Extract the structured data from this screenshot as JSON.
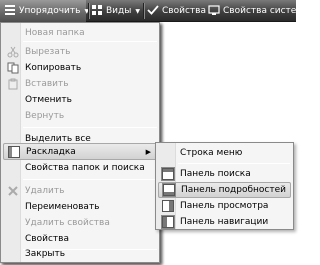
{
  "toolbar": {
    "organize": "Упорядочить",
    "views": "Виды",
    "properties": "Свойства",
    "system_properties": "Свойства системы"
  },
  "menu": {
    "new_folder": "Новая папка",
    "cut": "Вырезать",
    "copy": "Копировать",
    "paste": "Вставить",
    "undo": "Отменить",
    "redo": "Вернуть",
    "select_all": "Выделить все",
    "layout": "Раскладка",
    "folder_search_options": "Свойства папок и поиска",
    "delete": "Удалить",
    "rename": "Переименовать",
    "remove_properties": "Удалить свойства",
    "properties": "Свойства",
    "close": "Закрыть"
  },
  "submenu": {
    "menu_bar": "Строка меню",
    "search_pane": "Панель поиска",
    "details_pane": "Панель подробностей",
    "preview_pane": "Панель просмотра",
    "navigation_pane": "Панель навигации"
  },
  "icons": {
    "organize": "organize-icon",
    "views": "views-icon",
    "properties": "checkmark-icon",
    "system_properties": "system-properties-icon"
  }
}
